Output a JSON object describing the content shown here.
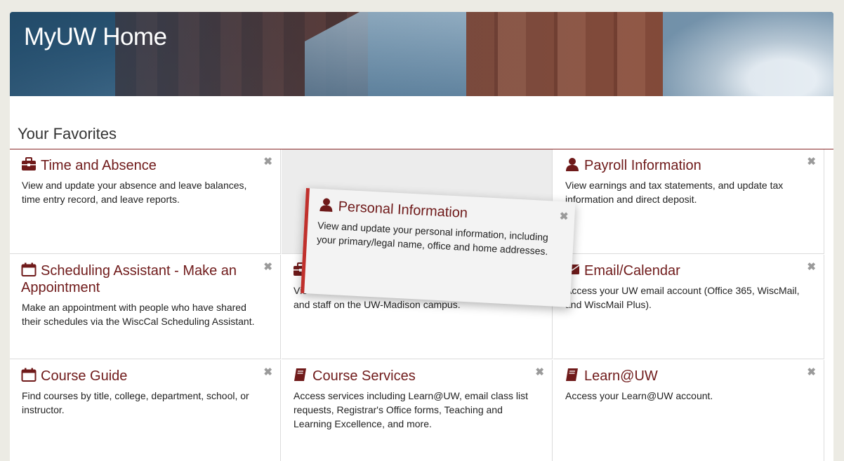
{
  "header": {
    "title": "MyUW Home"
  },
  "favorites": {
    "title": "Your Favorites",
    "close_glyph": "✖",
    "tiles": [
      {
        "title": "Time and Absence",
        "icon": "briefcase-icon",
        "description": "View and update your absence and leave balances, time entry record, and leave reports."
      },
      {
        "title": "Payroll Information",
        "icon": "user-icon",
        "description": "View earnings and tax statements, and update tax information and direct deposit."
      },
      {
        "title": "Scheduling Assistant - Make an Appointment",
        "icon": "calendar-icon",
        "description": "Make an appointment with people who have shared their schedules via the WiscCal Scheduling Assistant."
      },
      {
        "title": "",
        "icon": "briefcase-icon",
        "description_start": "Vie",
        "description_end": "and staff on the UW-Madison campus."
      },
      {
        "title": "Email/Calendar",
        "icon": "envelope-icon",
        "description": "Access your UW email account (Office 365, WiscMail, and WiscMail Plus)."
      },
      {
        "title": "Course Guide",
        "icon": "calendar-icon",
        "description": "Find courses by title, college, department, school, or instructor."
      },
      {
        "title": "Course Services",
        "icon": "book-icon",
        "description": "Access services including Learn@UW, email class list requests, Registrar's Office forms, Teaching and Learning Excellence, and more."
      },
      {
        "title": "Learn@UW",
        "icon": "book-icon",
        "description": "Access your Learn@UW account."
      }
    ],
    "dragging": {
      "title": "Personal Information",
      "icon": "user-icon",
      "description": "View and update your personal information, including your primary/legal name, office and home addresses."
    }
  },
  "colors": {
    "accent": "#6f1a1a",
    "drag_border": "#c0302c",
    "rule": "#8a2a2a"
  }
}
